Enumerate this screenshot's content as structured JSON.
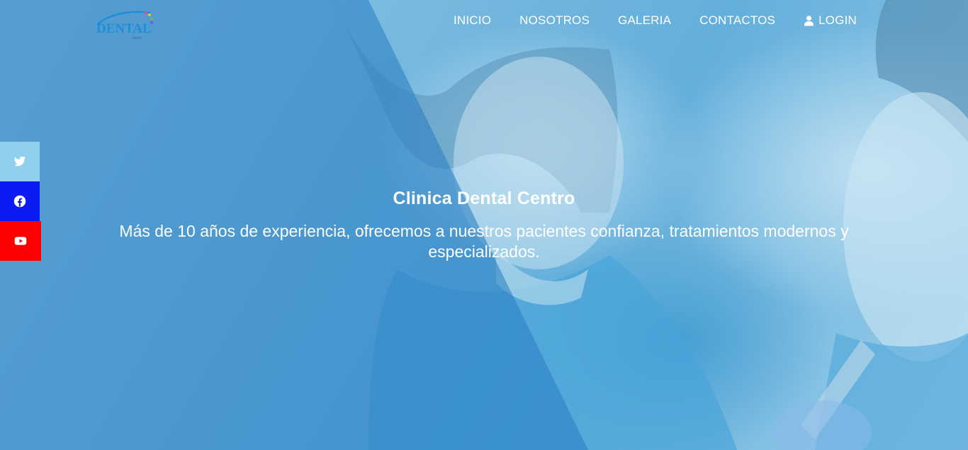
{
  "brand": {
    "logo_text": "DENTAL",
    "logo_sub": "centro"
  },
  "nav": {
    "items": [
      {
        "label": "INICIO"
      },
      {
        "label": "NOSOTROS"
      },
      {
        "label": "GALERIA"
      },
      {
        "label": "CONTACTOS"
      },
      {
        "label": "LOGIN",
        "icon": "user-icon"
      }
    ]
  },
  "hero": {
    "title": "Clinica Dental Centro",
    "subtitle": "Más de 10 años de experiencia, ofrecemos a nuestros pacientes confianza, tratamientos modernos y especializados."
  },
  "social": [
    {
      "name": "twitter",
      "icon": "twitter-icon",
      "color": "#8fd0ee"
    },
    {
      "name": "facebook",
      "icon": "facebook-icon",
      "color": "#0b1bf2"
    },
    {
      "name": "youtube",
      "icon": "youtube-icon",
      "color": "#ff0000"
    }
  ],
  "colors": {
    "overlay": "#3a8ccb",
    "text": "#ffffff",
    "logo": "#1f8ed8"
  }
}
